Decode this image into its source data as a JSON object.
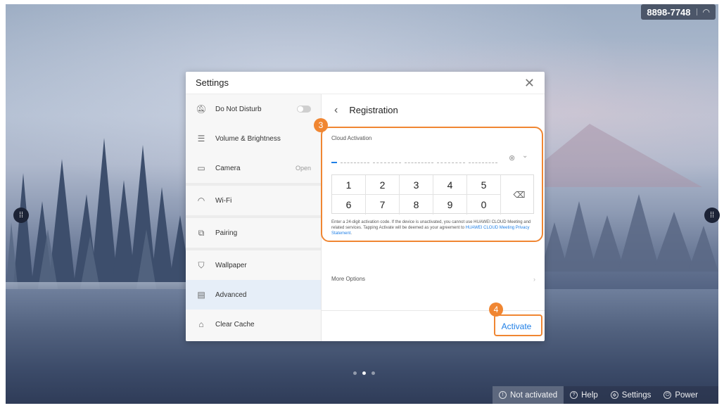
{
  "status": {
    "conference_id": "8898-7748",
    "wifi_icon": "wifi-icon"
  },
  "dialog": {
    "title": "Settings",
    "close_icon": "close-icon"
  },
  "sidebar": {
    "items": [
      {
        "label": "Do Not Disturb",
        "icon": "bell-off-icon",
        "toggle": "off"
      },
      {
        "label": "Volume & Brightness",
        "icon": "sliders-icon"
      },
      {
        "label": "Camera",
        "icon": "camera-icon",
        "value": "Open"
      },
      {
        "label": "Wi-Fi",
        "icon": "wifi-icon"
      },
      {
        "label": "Pairing",
        "icon": "pairing-icon"
      },
      {
        "label": "Wallpaper",
        "icon": "wallpaper-icon"
      },
      {
        "label": "Advanced",
        "icon": "advanced-icon",
        "active": true
      },
      {
        "label": "Clear Cache",
        "icon": "broom-icon"
      }
    ]
  },
  "panel": {
    "title": "Registration",
    "cloud_activation_label": "Cloud Activation",
    "keypad": {
      "row1": [
        "1",
        "2",
        "3",
        "4",
        "5"
      ],
      "row2": [
        "6",
        "7",
        "8",
        "9",
        "0"
      ]
    },
    "notice_text": "Enter a 24-digit activation code. If the device is unactivated, you cannot use HUAWEI CLOUD Meeting and related services. Tapping Activate will be deemed as your agreement to ",
    "notice_link": "HUAWEI CLOUD Meeting Privacy Statement",
    "notice_end": ".",
    "more_options": "More Options",
    "activate_label": "Activate"
  },
  "annotations": {
    "step_3": "3",
    "step_4": "4",
    "color": "#f08632"
  },
  "bottom_bar": {
    "items": [
      {
        "label": "Not activated",
        "icon": "info-icon"
      },
      {
        "label": "Help",
        "icon": "help-icon"
      },
      {
        "label": "Settings",
        "icon": "gear-icon"
      },
      {
        "label": "Power",
        "icon": "power-icon"
      }
    ]
  },
  "accent_color": "#1f7fe6"
}
